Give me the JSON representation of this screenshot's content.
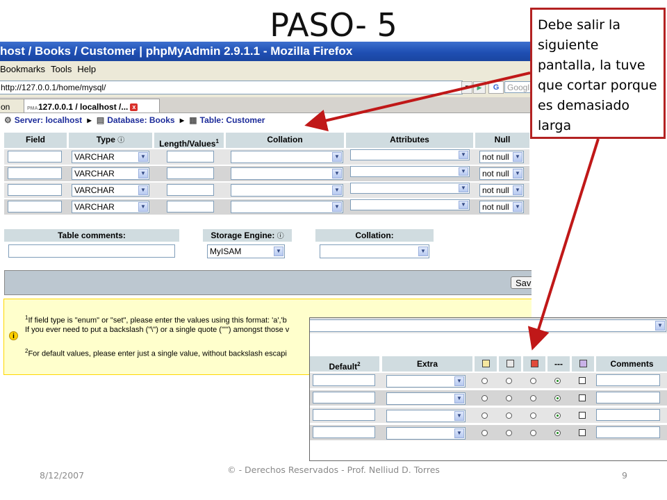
{
  "slide": {
    "title": "PASO- 5",
    "callout": "Debe salir la siguiente pantalla, la tuve que cortar porque es demasiado larga",
    "footer_date": "8/12/2007",
    "footer_center": "© - Derechos Reservados - Prof. Nelliud D. Torres",
    "page_number": "9",
    "arrow_color": "#c01818"
  },
  "browser": {
    "window_title": "host / Books / Customer | phpMyAdmin 2.9.1.1 - Mozilla Firefox",
    "menu": [
      "Bookmarks",
      "Tools",
      "Help"
    ],
    "url": "http://127.0.0.1/home/mysql/",
    "search_placeholder": "Googl",
    "tab_prev": "on",
    "tab_active": "127.0.0.1 / localhost /...",
    "tab_badge": "PMA"
  },
  "breadcrumb": {
    "server": "Server: localhost",
    "database": "Database: Books",
    "table": "Table: Customer"
  },
  "fields_table": {
    "headers": {
      "field": "Field",
      "type": "Type",
      "length": "Length/Values",
      "length_sup": "1",
      "collation": "Collation",
      "attributes": "Attributes",
      "null": "Null"
    },
    "rows": [
      {
        "field": "",
        "type": "VARCHAR",
        "length": "",
        "collation": "",
        "attributes": "",
        "null": "not null"
      },
      {
        "field": "",
        "type": "VARCHAR",
        "length": "",
        "collation": "",
        "attributes": "",
        "null": "not null"
      },
      {
        "field": "",
        "type": "VARCHAR",
        "length": "",
        "collation": "",
        "attributes": "",
        "null": "not null"
      },
      {
        "field": "",
        "type": "VARCHAR",
        "length": "",
        "collation": "",
        "attributes": "",
        "null": "not null"
      }
    ]
  },
  "table_options": {
    "comments_label": "Table comments:",
    "comments_value": "",
    "engine_label": "Storage Engine:",
    "engine_value": "MyISAM",
    "collation_label": "Collation:",
    "collation_value": ""
  },
  "save_button": "Sav",
  "notes": {
    "note1_num": "1",
    "note1_line1": "If field type is \"enum\" or \"set\", please enter the values using this format: 'a','b",
    "note1_line2": "If you ever need to put a backslash (\"\\\") or a single quote (\"'\") amongst those v",
    "note2_num": "2",
    "note2_text": "For default values, please enter just a single value, without backslash escapi"
  },
  "overlay_table": {
    "headers": {
      "default": "Default",
      "default_sup": "2",
      "extra": "Extra",
      "dashes": "---",
      "comments": "Comments"
    },
    "icons": [
      "primary-key-icon",
      "index-icon",
      "unique-icon",
      "fulltext-icon"
    ],
    "rows": [
      {
        "default": "",
        "extra": "",
        "selected": "none",
        "fulltext": false,
        "comment": ""
      },
      {
        "default": "",
        "extra": "",
        "selected": "none",
        "fulltext": false,
        "comment": ""
      },
      {
        "default": "",
        "extra": "",
        "selected": "none",
        "fulltext": false,
        "comment": ""
      },
      {
        "default": "",
        "extra": "",
        "selected": "none",
        "fulltext": false,
        "comment": ""
      }
    ]
  }
}
